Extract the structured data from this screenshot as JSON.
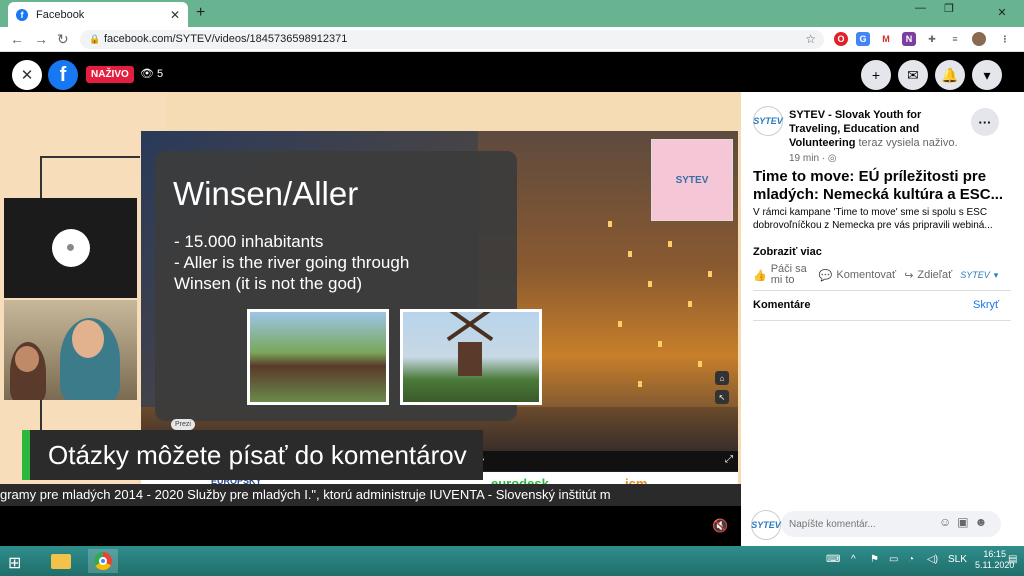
{
  "browser": {
    "tab_title": "Facebook",
    "tab_close": "✕",
    "new_tab": "+",
    "url": "facebook.com/SYTEV/videos/1845736598912371"
  },
  "video": {
    "live_label": "NAŽIVO",
    "viewer_count": "5",
    "slide_title": "Winsen/Aller",
    "slide_bullets": [
      "- 15.000 inhabitants",
      "- Aller is the river going through",
      "Winsen (it is not the god)"
    ],
    "prezi_label": "Prezi",
    "caption": "Otázky môžete písať do komentárov",
    "ticker": "gramy pre mladých 2014 - 2020 Služby pre mladých I.\", ktorú administruje IUVENTA - Slovenský inštitút m",
    "sponsor_eurodesk": "eurodesk",
    "sponsor_icm": "icm",
    "sponsor_eu": "EURÓPSKY"
  },
  "post": {
    "page_name": "SYTEV - Slovak Youth for Traveling, Education and Volunteering",
    "status_text": "teraz vysiela naživo.",
    "time": "19 min",
    "title": "Time to move: EÚ príležitosti pre mladých: Nemecká kultúra a ESC...",
    "description": "V rámci kampane 'Time to move' sme si spolu s ESC dobrovoľníčkou z Nemecka pre vás pripravili webiná...",
    "show_more": "Zobraziť viac",
    "like_label": "Páči sa mi to",
    "comment_label": "Komentovať",
    "share_label": "Zdieľať",
    "comments_header": "Komentáre",
    "hide_label": "Skryť",
    "comment_placeholder": "Napíšte komentár...",
    "avatar_text": "SYTEV"
  },
  "taskbar": {
    "lang": "SLK",
    "time": "16:15",
    "date": "5.11.2020"
  },
  "colors": {
    "facebook_blue": "#1877f2",
    "live_red": "#e41e3f",
    "caption_green": "#2db83d",
    "chrome_tab_green": "#68b490"
  }
}
